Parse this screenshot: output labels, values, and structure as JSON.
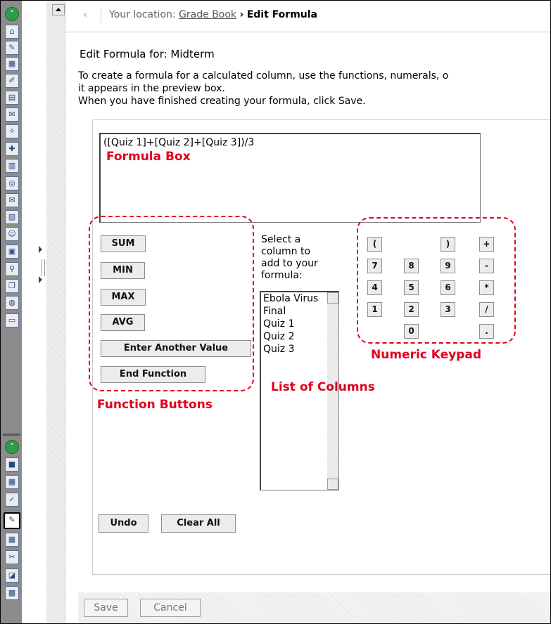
{
  "location": {
    "prefix": "Your location:",
    "link": "Grade Book",
    "arrow": "›",
    "current": "Edit Formula"
  },
  "heading": "Edit Formula for: Midterm",
  "intro": {
    "line1": "To create a formula for a calculated column, use the functions, numerals, o",
    "line2": "it appears in the preview box.",
    "line3": "When you have finished creating your formula, click Save."
  },
  "formula_value": "([Quiz 1]+[Quiz 2]+[Quiz 3])/3",
  "functions": {
    "sum": "SUM",
    "min": "MIN",
    "max": "MAX",
    "avg": "AVG",
    "enter_value": "Enter Another Value",
    "end_function": "End Function"
  },
  "columns": {
    "prompt": "Select a column to add to your formula:",
    "items": [
      "Ebola Virus",
      "Final",
      "Quiz 1",
      "Quiz 2",
      "Quiz 3"
    ]
  },
  "keypad": {
    "open_paren": "(",
    "close_paren": ")",
    "plus": "+",
    "seven": "7",
    "eight": "8",
    "nine": "9",
    "minus": "-",
    "four": "4",
    "five": "5",
    "six": "6",
    "multiply": "*",
    "one": "1",
    "two": "2",
    "three": "3",
    "divide": "/",
    "zero": "0",
    "dot": "."
  },
  "actions": {
    "undo": "Undo",
    "clear_all": "Clear All"
  },
  "footer": {
    "save": "Save",
    "cancel": "Cancel"
  },
  "annotations": {
    "formula_box": "Formula Box",
    "function_buttons": "Function Buttons",
    "list_of_columns": "List of Columns",
    "numeric_keypad": "Numeric Keypad"
  },
  "colors": {
    "annotation_red": "#e0001b",
    "toolstrip_gray": "#8c8c8c",
    "nav_green": "#2f9c4a"
  },
  "toolstrip_icons": [
    "collapse-up-icon",
    "home-icon",
    "syllabus-icon",
    "calendar-icon",
    "assignments-icon",
    "content-icon",
    "discussion-icon",
    "pin-icon",
    "media-icon",
    "documents-icon",
    "target-icon",
    "mail-icon",
    "notes-icon",
    "people-icon",
    "scorm-icon",
    "search-icon",
    "copy-icon",
    "globe-icon",
    "print-icon",
    "collapse-up-icon",
    "box-icon",
    "calendar-icon",
    "gradebook-icon",
    "edit-icon",
    "grid-icon",
    "tools-icon",
    "chart-icon"
  ]
}
